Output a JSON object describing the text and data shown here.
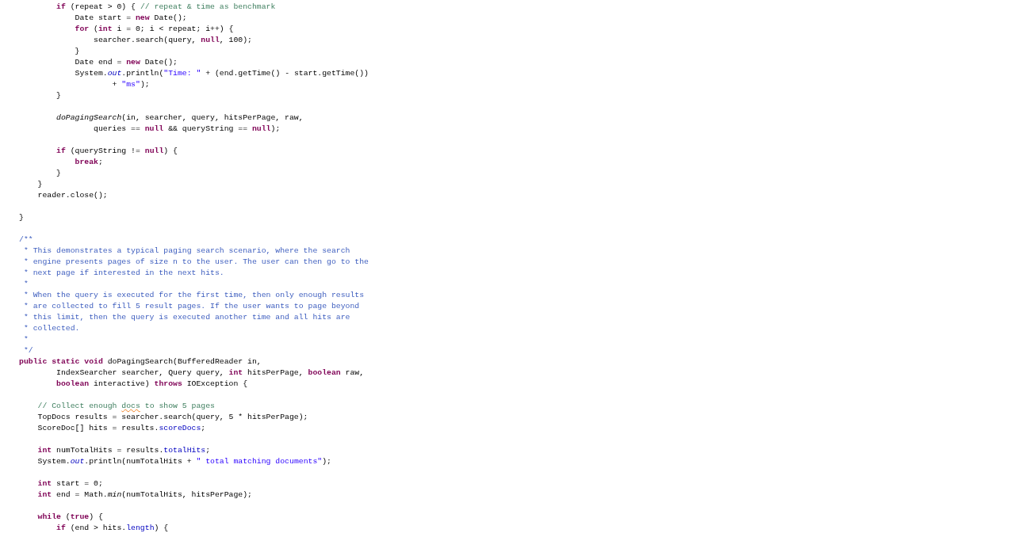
{
  "editor": {
    "lines": [
      {
        "kind": "group",
        "children": [
          {
            "kind": "group",
            "children": [
              {
                "kind": "code",
                "tokens": [
                  {
                    "kind": "keyword",
                    "text": "if"
                  },
                  {
                    "kind": "plain",
                    "text": " (repeat > 0) { "
                  },
                  {
                    "kind": "comment",
                    "text": "// repeat & time as benchmark"
                  }
                ],
                "children": [
                  {
                    "kind": "code",
                    "tokens": [
                      {
                        "kind": "plain",
                        "text": "Date start = "
                      },
                      {
                        "kind": "keyword",
                        "text": "new"
                      },
                      {
                        "kind": "plain",
                        "text": " Date();"
                      }
                    ]
                  },
                  {
                    "kind": "code",
                    "tokens": [
                      {
                        "kind": "keyword",
                        "text": "for"
                      },
                      {
                        "kind": "plain",
                        "text": " ("
                      },
                      {
                        "kind": "keyword",
                        "text": "int"
                      },
                      {
                        "kind": "plain",
                        "text": " i = 0; i < repeat; i++) {"
                      }
                    ],
                    "children": [
                      {
                        "kind": "code",
                        "tokens": [
                          {
                            "kind": "plain",
                            "text": "searcher.search(query, "
                          },
                          {
                            "kind": "keyword",
                            "text": "null"
                          },
                          {
                            "kind": "plain",
                            "text": ", 100);"
                          }
                        ]
                      }
                    ]
                  },
                  {
                    "kind": "code",
                    "tokens": [
                      {
                        "kind": "plain",
                        "text": "}"
                      }
                    ]
                  },
                  {
                    "kind": "code",
                    "tokens": [
                      {
                        "kind": "plain",
                        "text": "Date end = "
                      },
                      {
                        "kind": "keyword",
                        "text": "new"
                      },
                      {
                        "kind": "plain",
                        "text": " Date();"
                      }
                    ]
                  },
                  {
                    "kind": "code",
                    "tokens": [
                      {
                        "kind": "plain",
                        "text": "System."
                      },
                      {
                        "kind": "static_field",
                        "text": "out"
                      },
                      {
                        "kind": "plain",
                        "text": ".println("
                      },
                      {
                        "kind": "string",
                        "text": "\"Time: \""
                      },
                      {
                        "kind": "plain",
                        "text": " + (end.getTime() - start.getTime())"
                      }
                    ],
                    "children": [
                      {
                        "kind": "group",
                        "children": [
                          {
                            "kind": "code",
                            "tokens": [
                              {
                                "kind": "plain",
                                "text": "+ "
                              },
                              {
                                "kind": "string",
                                "text": "\"ms\""
                              },
                              {
                                "kind": "plain",
                                "text": ");"
                              }
                            ]
                          }
                        ]
                      }
                    ]
                  }
                ]
              },
              {
                "kind": "code",
                "tokens": [
                  {
                    "kind": "plain",
                    "text": "}"
                  }
                ]
              },
              {
                "kind": "blank"
              },
              {
                "kind": "code",
                "tokens": [
                  {
                    "kind": "static_method",
                    "text": "doPagingSearch"
                  },
                  {
                    "kind": "plain",
                    "text": "(in, searcher, query, hitsPerPage, raw,"
                  }
                ],
                "children": [
                  {
                    "kind": "group",
                    "children": [
                      {
                        "kind": "code",
                        "tokens": [
                          {
                            "kind": "plain",
                            "text": "queries == "
                          },
                          {
                            "kind": "keyword",
                            "text": "null"
                          },
                          {
                            "kind": "plain",
                            "text": " && queryString == "
                          },
                          {
                            "kind": "keyword",
                            "text": "null"
                          },
                          {
                            "kind": "plain",
                            "text": ");"
                          }
                        ]
                      }
                    ]
                  }
                ]
              },
              {
                "kind": "blank"
              },
              {
                "kind": "code",
                "tokens": [
                  {
                    "kind": "keyword",
                    "text": "if"
                  },
                  {
                    "kind": "plain",
                    "text": " (queryString != "
                  },
                  {
                    "kind": "keyword",
                    "text": "null"
                  },
                  {
                    "kind": "plain",
                    "text": ") {"
                  }
                ],
                "children": [
                  {
                    "kind": "code",
                    "tokens": [
                      {
                        "kind": "keyword",
                        "text": "break"
                      },
                      {
                        "kind": "plain",
                        "text": ";"
                      }
                    ]
                  }
                ]
              },
              {
                "kind": "code",
                "tokens": [
                  {
                    "kind": "plain",
                    "text": "}"
                  }
                ]
              }
            ]
          },
          {
            "kind": "code",
            "tokens": [
              {
                "kind": "plain",
                "text": "}"
              }
            ]
          },
          {
            "kind": "code",
            "tokens": [
              {
                "kind": "plain",
                "text": "reader.close();"
              }
            ]
          }
        ]
      },
      {
        "kind": "blank"
      },
      {
        "kind": "code",
        "tokens": [
          {
            "kind": "plain",
            "text": "}"
          }
        ]
      },
      {
        "kind": "blank"
      },
      {
        "kind": "code",
        "tokens": [
          {
            "kind": "javadoc",
            "text": "/**"
          }
        ]
      },
      {
        "kind": "code",
        "tokens": [
          {
            "kind": "javadoc",
            "text": " * This demonstrates a typical paging search scenario, where the search"
          }
        ]
      },
      {
        "kind": "code",
        "tokens": [
          {
            "kind": "javadoc",
            "text": " * engine presents pages of size n to the user. The user can then go to the"
          }
        ]
      },
      {
        "kind": "code",
        "tokens": [
          {
            "kind": "javadoc",
            "text": " * next page if interested in the next hits."
          }
        ]
      },
      {
        "kind": "code",
        "tokens": [
          {
            "kind": "javadoc",
            "text": " *"
          }
        ]
      },
      {
        "kind": "code",
        "tokens": [
          {
            "kind": "javadoc",
            "text": " * When the query is executed for the first time, then only enough results"
          }
        ]
      },
      {
        "kind": "code",
        "tokens": [
          {
            "kind": "javadoc",
            "text": " * are collected to fill 5 result pages. If the user wants to page beyond"
          }
        ]
      },
      {
        "kind": "code",
        "tokens": [
          {
            "kind": "javadoc",
            "text": " * this limit, then the query is executed another time and all hits are"
          }
        ]
      },
      {
        "kind": "code",
        "tokens": [
          {
            "kind": "javadoc",
            "text": " * collected."
          }
        ]
      },
      {
        "kind": "code",
        "tokens": [
          {
            "kind": "javadoc",
            "text": " *"
          }
        ]
      },
      {
        "kind": "code",
        "tokens": [
          {
            "kind": "javadoc",
            "text": " */"
          }
        ]
      },
      {
        "kind": "code",
        "tokens": [
          {
            "kind": "keyword",
            "text": "public static void"
          },
          {
            "kind": "plain",
            "text": " doPagingSearch(BufferedReader in,"
          }
        ],
        "children": [
          {
            "kind": "group",
            "children": [
              {
                "kind": "code",
                "tokens": [
                  {
                    "kind": "plain",
                    "text": "IndexSearcher searcher, Query query, "
                  },
                  {
                    "kind": "keyword",
                    "text": "int"
                  },
                  {
                    "kind": "plain",
                    "text": " hitsPerPage, "
                  },
                  {
                    "kind": "keyword",
                    "text": "boolean"
                  },
                  {
                    "kind": "plain",
                    "text": " raw,"
                  }
                ]
              },
              {
                "kind": "code",
                "tokens": [
                  {
                    "kind": "keyword",
                    "text": "boolean"
                  },
                  {
                    "kind": "plain",
                    "text": " interactive) "
                  },
                  {
                    "kind": "keyword",
                    "text": "throws"
                  },
                  {
                    "kind": "plain",
                    "text": " IOException {"
                  }
                ]
              }
            ]
          },
          {
            "kind": "blank"
          },
          {
            "kind": "code",
            "tokens": [
              {
                "kind": "comment",
                "text": "// Collect enough "
              },
              {
                "kind": "misspelled",
                "text": "docs"
              },
              {
                "kind": "comment",
                "text": " to show 5 pages"
              }
            ]
          },
          {
            "kind": "code",
            "tokens": [
              {
                "kind": "plain",
                "text": "TopDocs results = searcher.search(query, 5 * hitsPerPage);"
              }
            ]
          },
          {
            "kind": "code",
            "tokens": [
              {
                "kind": "plain",
                "text": "ScoreDoc[] hits = results."
              },
              {
                "kind": "field",
                "text": "scoreDocs"
              },
              {
                "kind": "plain",
                "text": ";"
              }
            ]
          },
          {
            "kind": "blank"
          },
          {
            "kind": "code",
            "tokens": [
              {
                "kind": "keyword",
                "text": "int"
              },
              {
                "kind": "plain",
                "text": " numTotalHits = results."
              },
              {
                "kind": "field",
                "text": "totalHits"
              },
              {
                "kind": "plain",
                "text": ";"
              }
            ]
          },
          {
            "kind": "code",
            "tokens": [
              {
                "kind": "plain",
                "text": "System."
              },
              {
                "kind": "static_field",
                "text": "out"
              },
              {
                "kind": "plain",
                "text": ".println(numTotalHits + "
              },
              {
                "kind": "string",
                "text": "\" total matching documents\""
              },
              {
                "kind": "plain",
                "text": ");"
              }
            ]
          },
          {
            "kind": "blank"
          },
          {
            "kind": "code",
            "tokens": [
              {
                "kind": "keyword",
                "text": "int"
              },
              {
                "kind": "plain",
                "text": " start = 0;"
              }
            ]
          },
          {
            "kind": "code",
            "tokens": [
              {
                "kind": "keyword",
                "text": "int"
              },
              {
                "kind": "plain",
                "text": " end = Math."
              },
              {
                "kind": "static_method",
                "text": "min"
              },
              {
                "kind": "plain",
                "text": "(numTotalHits, hitsPerPage);"
              }
            ]
          },
          {
            "kind": "blank"
          },
          {
            "kind": "code",
            "tokens": [
              {
                "kind": "keyword",
                "text": "while"
              },
              {
                "kind": "plain",
                "text": " ("
              },
              {
                "kind": "keyword",
                "text": "true"
              },
              {
                "kind": "plain",
                "text": ") {"
              }
            ],
            "children": [
              {
                "kind": "code",
                "tokens": [
                  {
                    "kind": "keyword",
                    "text": "if"
                  },
                  {
                    "kind": "plain",
                    "text": " (end > hits."
                  },
                  {
                    "kind": "field",
                    "text": "length"
                  },
                  {
                    "kind": "plain",
                    "text": ") {"
                  }
                ]
              }
            ]
          }
        ]
      }
    ]
  }
}
